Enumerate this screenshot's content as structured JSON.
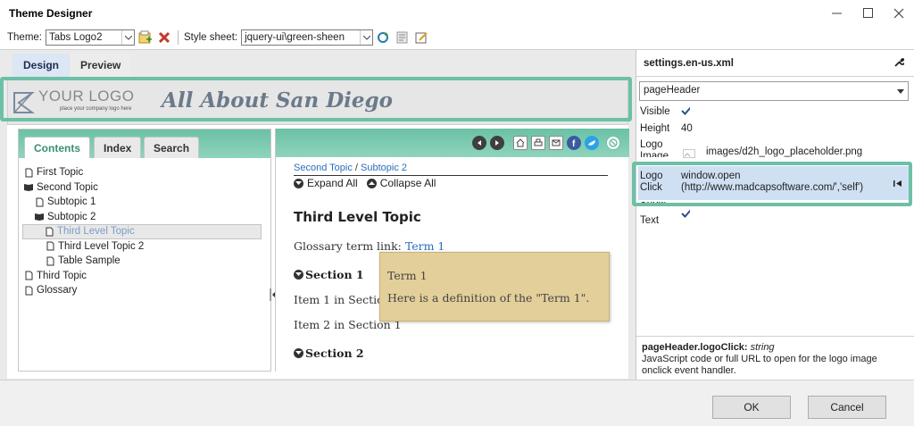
{
  "window": {
    "title": "Theme Designer"
  },
  "toolbar": {
    "theme_label": "Theme:",
    "theme_value": "Tabs Logo2",
    "stylesheet_label": "Style sheet:",
    "stylesheet_value": "jquery-ui\\green-sheen"
  },
  "tabs": [
    "Design",
    "Preview"
  ],
  "preview": {
    "logo_text": "YOUR LOGO",
    "logo_subtext": "place your company logo here",
    "site_title": "All About San Diego",
    "nav_tabs": [
      "Contents",
      "Index",
      "Search"
    ],
    "tree": [
      {
        "label": "First Topic",
        "icon": "page-icon"
      },
      {
        "label": "Second Topic",
        "icon": "open-book-icon"
      },
      {
        "label": "Subtopic 1",
        "icon": "page-icon"
      },
      {
        "label": "Subtopic 2",
        "icon": "open-book-icon"
      },
      {
        "label": "Third Level Topic",
        "icon": "page-icon"
      },
      {
        "label": "Third Level Topic 2",
        "icon": "page-icon"
      },
      {
        "label": "Table Sample",
        "icon": "page-icon"
      },
      {
        "label": "Third Topic",
        "icon": "page-icon"
      },
      {
        "label": "Glossary",
        "icon": "page-icon"
      }
    ],
    "breadcrumb": {
      "part1": "Second Topic",
      "sep": " / ",
      "part2": "Subtopic 2"
    },
    "expand_all": "Expand All",
    "collapse_all": "Collapse All",
    "topic_title": "Third Level Topic",
    "glossary_prefix": "Glossary term link: ",
    "glossary_link": "Term 1",
    "section1": "Section 1",
    "item1": "Item 1 in Section",
    "item2": "Item 2 in Section 1",
    "section2": "Section 2",
    "popup": {
      "title": "Term 1",
      "definition": "Here is a definition of the \"Term 1\"."
    }
  },
  "properties": {
    "file": "settings.en-us.xml",
    "selector": "pageHeader",
    "visible_label": "Visible",
    "height_label": "Height",
    "height_value": "40",
    "logo_image_label_1": "Logo",
    "logo_image_label_2": "Image",
    "logo_image_value": "images/d2h_logo_placeholder.png",
    "logo_click_label_1": "Logo",
    "logo_click_label_2": "Click",
    "logo_click_value_1": "window.open",
    "logo_click_value_2": "(http://www.madcapsoftware.com/','self')",
    "show_text_label_1": "Show",
    "show_text_label_2": "Text",
    "desc_name": "pageHeader.logoClick:",
    "desc_type": "string",
    "desc_text": "JavaScript code or full URL to open for the logo image onclick event handler."
  },
  "buttons": {
    "ok": "OK",
    "cancel": "Cancel"
  },
  "colors": {
    "accent": "#6cc0a6",
    "title_text": "#6b7a8a",
    "link": "#2a6ebc",
    "popup_bg": "#e3cf9a"
  }
}
